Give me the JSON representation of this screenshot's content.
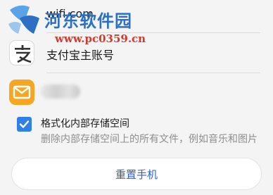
{
  "accounts": [
    {
      "icon": "wifi-cloud-icon",
      "label": "wifi.com"
    },
    {
      "icon": "alipay-icon",
      "label": "支付宝主账号"
    },
    {
      "icon": "email-icon",
      "label": ""
    }
  ],
  "watermark": {
    "name": "河东软件园",
    "url": "www.pc0359.cn"
  },
  "format_option": {
    "checked": true,
    "title": "格式化内部存储空间",
    "description": "删除内部存储空间上的所有文件，例如音乐和图片"
  },
  "reset_button": {
    "label": "重置手机"
  },
  "colors": {
    "accent": "#2f7fe6",
    "alipay": "#1a91e0",
    "email": "#f5a623"
  }
}
